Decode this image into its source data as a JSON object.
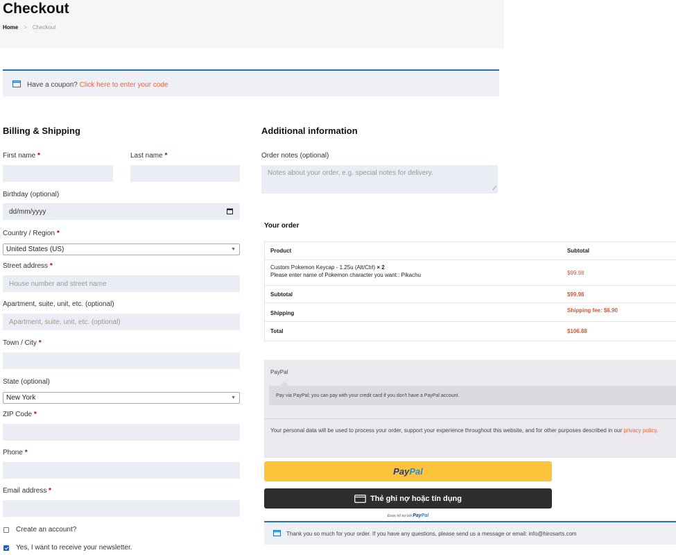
{
  "header": {
    "title": "Checkout",
    "breadcrumb": {
      "home": "Home",
      "separator": ">",
      "current": "Checkout"
    }
  },
  "coupon": {
    "icon": "calendar-icon",
    "text": "Have a coupon?",
    "link": "Click here to enter your code"
  },
  "billing": {
    "title": "Billing & Shipping",
    "required_mark": "*",
    "first_name": {
      "label": "First name",
      "value": ""
    },
    "last_name": {
      "label": "Last name",
      "value": ""
    },
    "birthday": {
      "label": "Birthday (optional)",
      "placeholder": "dd/mm/yyyy"
    },
    "country": {
      "label": "Country / Region",
      "selected": "United States (US)"
    },
    "street": {
      "label": "Street address",
      "placeholder": "House number and street name"
    },
    "apartment": {
      "label": "Apartment, suite, unit, etc. (optional)",
      "placeholder": "Apartment, suite, unit, etc. (optional)"
    },
    "city": {
      "label": "Town / City",
      "value": ""
    },
    "state": {
      "label": "State (optional)",
      "selected": "New York"
    },
    "zip": {
      "label": "ZIP Code",
      "value": ""
    },
    "phone": {
      "label": "Phone",
      "value": ""
    },
    "email": {
      "label": "Email address",
      "value": ""
    },
    "create_account": {
      "label": "Create an account?",
      "checked": false
    },
    "newsletter": {
      "label": "Yes, I want to receive your newsletter.",
      "checked": true
    }
  },
  "additional": {
    "title": "Additional information",
    "notes_label": "Order notes (optional)",
    "notes_placeholder": "Notes about your order, e.g. special notes for delivery."
  },
  "order": {
    "title": "Your order",
    "col_product": "Product",
    "col_subtotal": "Subtotal",
    "item": {
      "name": "Custom Pokemon Keycap - 1.25u (Alt/Ctrl)",
      "qty": "× 2",
      "note": "Please enter name of Pokemon character you want:: Pikachu",
      "price": "$99.98"
    },
    "subtotal_label": "Subtotal",
    "subtotal_value": "$99.98",
    "shipping_label": "Shipping",
    "shipping_value": "Shipping fee: $6.90",
    "total_label": "Total",
    "total_value": "$106.88"
  },
  "payment": {
    "method": "PayPal",
    "description": "Pay via PayPal; you can pay with your credit card if you don't have a PayPal account.",
    "privacy_text": "Your personal data will be used to process your order, support your experience throughout this website, and for other purposes described in our",
    "privacy_link": "privacy policy",
    "privacy_end": ".",
    "paypal_button": {
      "pay": "Pay",
      "pal": "Pal"
    },
    "card_button": "Thẻ ghi nợ hoặc tín dụng",
    "powered_by": "Được hỗ trợ bởi",
    "powered_pay": "Pay",
    "powered_pal": "Pal"
  },
  "thanks": {
    "text": "Thank you so much for your order. If you have any questions, please send us a message or email: info@hirosarts.com"
  },
  "colors": {
    "accent": "#1e73be",
    "link": "#f0603a",
    "input_bg": "#eaedf3",
    "paypal_yellow": "#fcc43a",
    "card_dark": "#2c2e2f"
  }
}
